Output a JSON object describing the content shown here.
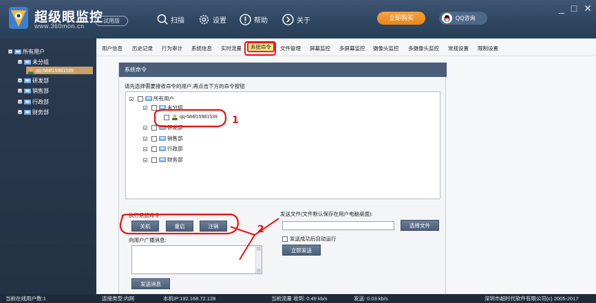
{
  "header": {
    "brand": "超级眼监控",
    "brand_url": "www.360mon.cn",
    "trial_badge": "试用版",
    "nav": [
      {
        "label": "扫描",
        "icon": "search-icon"
      },
      {
        "label": "设置",
        "icon": "gear-icon"
      },
      {
        "label": "帮助",
        "icon": "info-icon"
      },
      {
        "label": "关于",
        "icon": "arrow-circle-icon"
      }
    ],
    "buy_label": "立即购买",
    "qq_label": "QQ咨询",
    "window_controls": [
      "_",
      "□",
      "✕"
    ]
  },
  "left_tree": {
    "items": [
      {
        "label": "所有用户",
        "level": 0
      },
      {
        "label": "未分组",
        "level": 1
      },
      {
        "label": "qq-584f15981539",
        "level": 2,
        "selected": true
      },
      {
        "label": "研发部",
        "level": 1
      },
      {
        "label": "销售部",
        "level": 1
      },
      {
        "label": "行政部",
        "level": 1
      },
      {
        "label": "财务部",
        "level": 1
      }
    ]
  },
  "tabs": [
    {
      "label": "用户信息"
    },
    {
      "label": "历史记录"
    },
    {
      "label": "行为审计"
    },
    {
      "label": "系统信息"
    },
    {
      "label": "实时流量"
    },
    {
      "label": "系统命令",
      "active": true
    },
    {
      "label": "文件管理"
    },
    {
      "label": "屏幕监控"
    },
    {
      "label": "多屏幕监控"
    },
    {
      "label": "摄像头监控"
    },
    {
      "label": "多摄像头监控"
    },
    {
      "label": "常规设置"
    },
    {
      "label": "限制设置"
    }
  ],
  "panel": {
    "title": "系统命令",
    "instruction": "请先选择需要接收命令的用户,再点击下方的命令按钮",
    "tree": [
      {
        "label": "所有用户"
      },
      {
        "label": "未分组"
      },
      {
        "label": "qq-584f15981539"
      },
      {
        "label": "研发部"
      },
      {
        "label": "销售部"
      },
      {
        "label": "行政部"
      },
      {
        "label": "财务部"
      }
    ],
    "exec_label": "执行系统命令:",
    "shutdown_btn": "关机",
    "restart_btn": "重启",
    "logoff_btn": "注销",
    "broadcast_label": "向用户广播消息:",
    "send_msg_btn": "发送消息",
    "send_file_label": "发送文件(文件默认保存在用户电脑桌面):",
    "choose_file_btn": "选择文件",
    "autorun_label": "发送成功后自动运行",
    "send_now_btn": "立即发送",
    "annotation_1": "1",
    "annotation_2": "2"
  },
  "statusbar": {
    "online_users": "当前在线用户数:1",
    "conn_type": "连接类型:内网",
    "local_ip": "本机IP:192.168.72.128",
    "traffic_recv": "当前流量 收到: 0.49 kb/s",
    "traffic_send": "发送: 0.03 kb/s",
    "copyright": "深圳市超时代软件有限公司(c) 2005-2017"
  },
  "colors": {
    "header_bg": "#2e4560",
    "accent_orange": "#f09630",
    "panel_title_bg": "#4b5f7b",
    "annotation_red": "#e11111"
  }
}
